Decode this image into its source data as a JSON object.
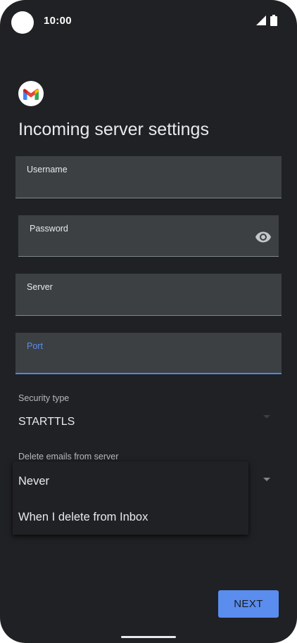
{
  "status_bar": {
    "time": "10:00"
  },
  "app": {
    "logo_icon": "gmail-icon",
    "brand_colors": [
      "#ea4335",
      "#4285f4",
      "#34a853",
      "#fbbc04"
    ]
  },
  "page": {
    "title": "Incoming server settings"
  },
  "form": {
    "username": {
      "label": "Username",
      "value": ""
    },
    "password": {
      "label": "Password",
      "value": "",
      "toggle_icon": "eye-icon"
    },
    "server": {
      "label": "Server",
      "value": ""
    },
    "port": {
      "label": "Port",
      "value": "",
      "focused": true
    }
  },
  "security": {
    "label": "Security type",
    "value": "STARTTLS"
  },
  "delete_emails": {
    "label": "Delete emails from server",
    "options": [
      "Never",
      "When I delete from Inbox"
    ]
  },
  "actions": {
    "next_label": "NEXT"
  },
  "colors": {
    "background": "#202124",
    "field": "#3c4043",
    "accent": "#5b8def"
  }
}
